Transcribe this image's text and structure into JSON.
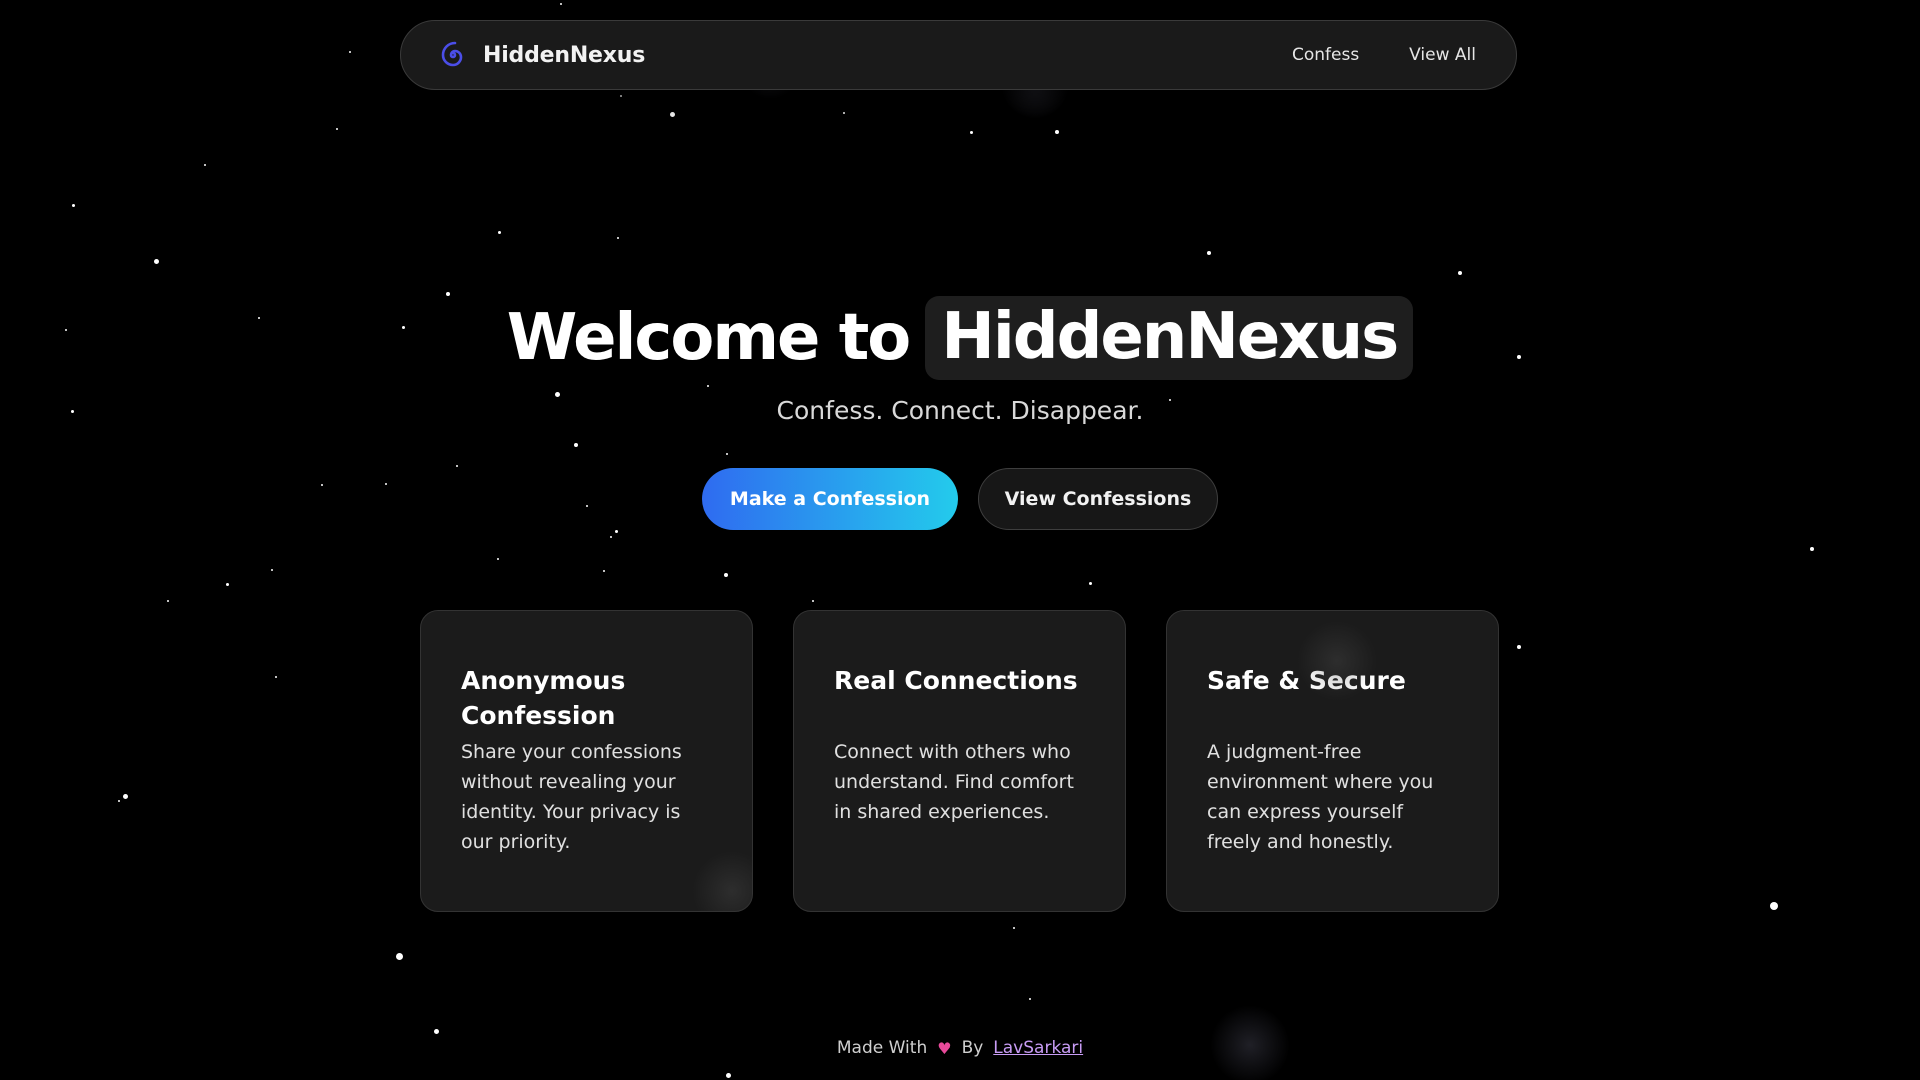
{
  "navbar": {
    "logo_icon": "swirl-icon",
    "brand_name": "HiddenNexus",
    "links": [
      "Confess",
      "View All"
    ]
  },
  "hero": {
    "title_prefix": "Welcome to",
    "title_brand": "HiddenNexus",
    "subtitle": "Confess. Connect. Disappear.",
    "primary_button": "Make a Confession",
    "secondary_button": "View Confessions"
  },
  "features": [
    {
      "title": "Anonymous Confession",
      "text": "Share your confessions without revealing your identity. Your privacy is our priority."
    },
    {
      "title": "Real Connections",
      "text": "Connect with others who understand. Find comfort in shared experiences."
    },
    {
      "title": "Safe & Secure",
      "text": "A judgment-free environment where you can express yourself freely and honestly."
    }
  ],
  "footer": {
    "made_with": "Made With",
    "heart_icon": "heart-icon",
    "by": "By",
    "author": "LavSarkari"
  },
  "colors": {
    "background": "#000000",
    "primary_gradient_start": "#2f6bf0",
    "primary_gradient_end": "#23cbec",
    "logo": "#4b4ee8",
    "heart": "#e84a9a",
    "author_link": "#c89cf5"
  }
}
